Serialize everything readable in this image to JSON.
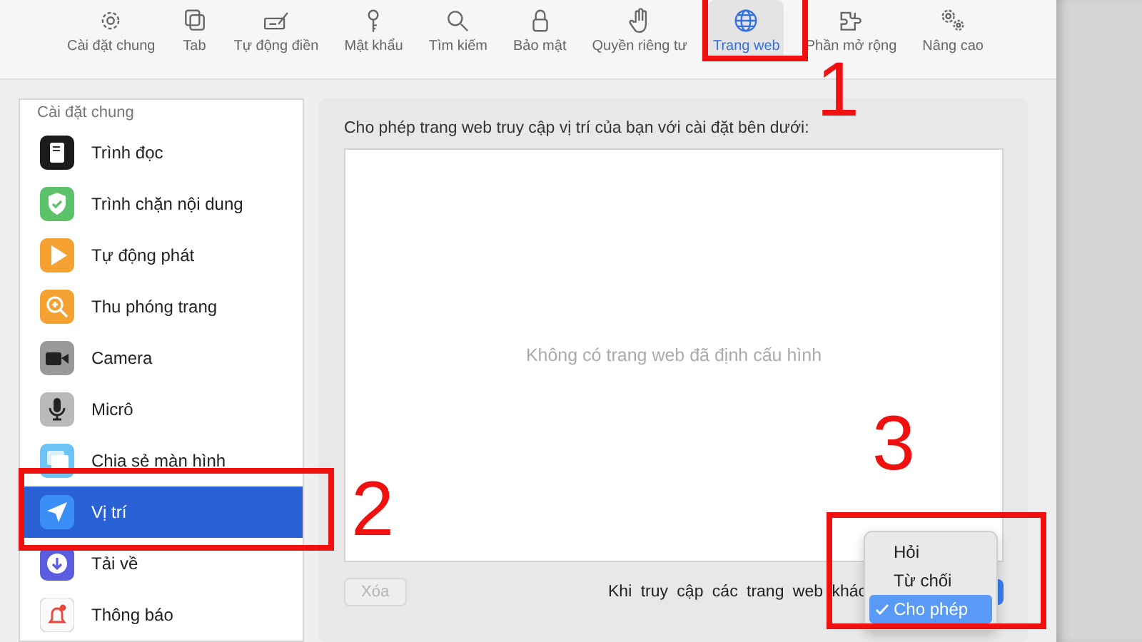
{
  "toolbar": [
    {
      "label": "Cài đặt chung",
      "kind": "gear",
      "selected": false
    },
    {
      "label": "Tab",
      "kind": "tabs",
      "selected": false
    },
    {
      "label": "Tự động điền",
      "kind": "autofill",
      "selected": false
    },
    {
      "label": "Mật khẩu",
      "kind": "key",
      "selected": false
    },
    {
      "label": "Tìm kiếm",
      "kind": "search",
      "selected": false
    },
    {
      "label": "Bảo mật",
      "kind": "lock",
      "selected": false
    },
    {
      "label": "Quyền riêng tư",
      "kind": "hand",
      "selected": false
    },
    {
      "label": "Trang web",
      "kind": "globe",
      "selected": true
    },
    {
      "label": "Phần mở rộng",
      "kind": "puzzle",
      "selected": false
    },
    {
      "label": "Nâng cao",
      "kind": "gears",
      "selected": false
    }
  ],
  "sidebar": {
    "header": "Cài đặt chung",
    "items": [
      {
        "label": "Trình đọc",
        "kind": "reader",
        "selected": false
      },
      {
        "label": "Trình chặn nội dung",
        "kind": "shield",
        "selected": false
      },
      {
        "label": "Tự động phát",
        "kind": "play",
        "selected": false
      },
      {
        "label": "Thu phóng trang",
        "kind": "zoom",
        "selected": false
      },
      {
        "label": "Camera",
        "kind": "camera",
        "selected": false
      },
      {
        "label": "Micrô",
        "kind": "mic",
        "selected": false
      },
      {
        "label": "Chia sẻ màn hình",
        "kind": "screen",
        "selected": false
      },
      {
        "label": "Vị trí",
        "kind": "location",
        "selected": true
      },
      {
        "label": "Tải về",
        "kind": "download",
        "selected": false
      },
      {
        "label": "Thông báo",
        "kind": "bell",
        "selected": false
      }
    ]
  },
  "panel": {
    "description": "Cho phép trang web truy cập vị trí của bạn với cài đặt bên dưới:",
    "empty_message": "Không có trang web đã định cấu hình",
    "remove_button": {
      "label": "Xóa",
      "disabled": true
    },
    "other_sites_label": "Khi truy cập các trang web khác",
    "menu": [
      {
        "label": "Hỏi",
        "selected": false
      },
      {
        "label": "Từ chối",
        "selected": false
      },
      {
        "label": "Cho phép",
        "selected": true
      }
    ]
  },
  "annotations": [
    {
      "label": "1",
      "kind": "toolbar"
    },
    {
      "label": "2",
      "kind": "sidebar"
    },
    {
      "label": "3",
      "kind": "menu"
    }
  ]
}
